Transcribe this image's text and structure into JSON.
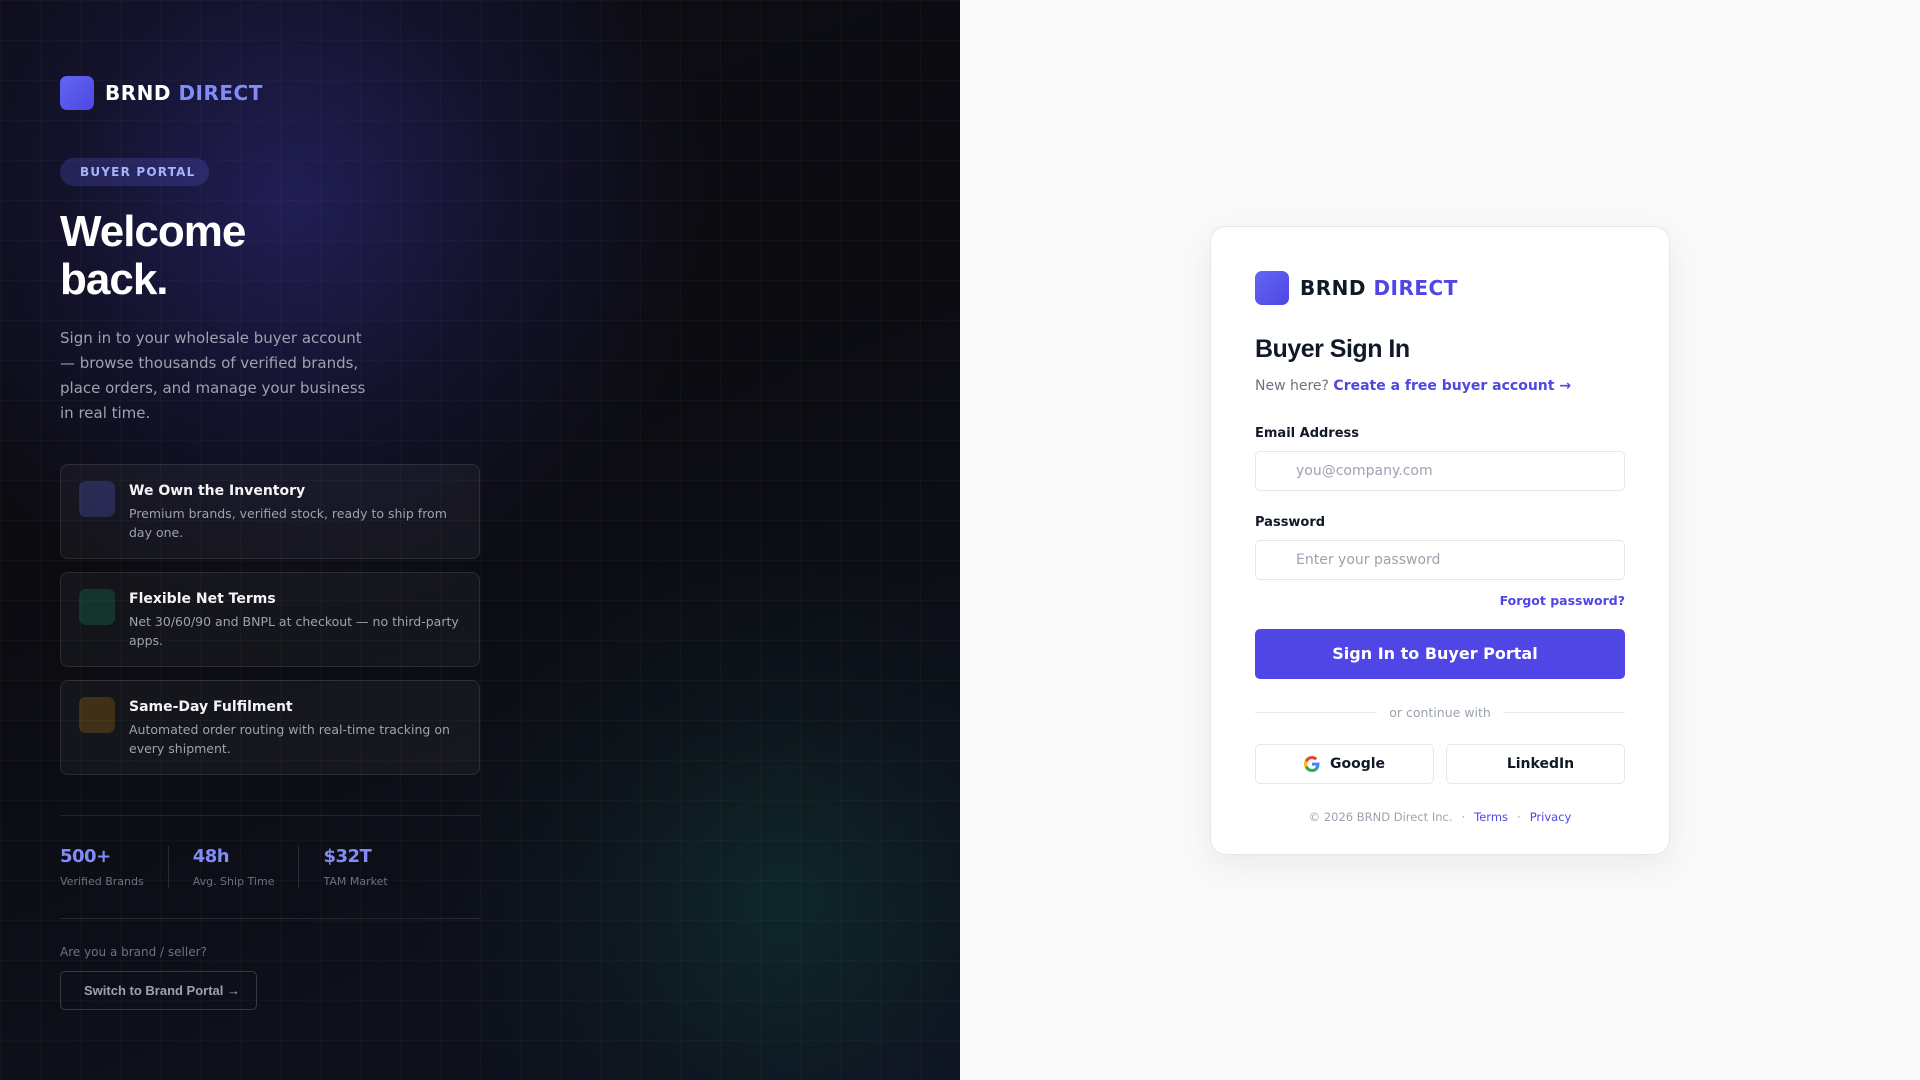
{
  "brand": {
    "name_primary": "BRND",
    "name_accent": "DIRECT",
    "logo_icon": "",
    "colors": {
      "accent": "#4f46e5",
      "accent_light": "#818cf8",
      "dark_bg": "#0b0b10"
    }
  },
  "left": {
    "badge_icon": "",
    "badge_label": "BUYER PORTAL",
    "headline_line1": "Welcome",
    "headline_line2": "back.",
    "intro": "Sign in to your wholesale buyer account — browse thousands of verified brands, place orders, and manage your business in real time.",
    "features": [
      {
        "icon": "",
        "icon_name": "warehouse-icon",
        "title": "We Own the Inventory",
        "description": "Premium brands, verified stock, ready to ship from day one."
      },
      {
        "icon": "",
        "icon_name": "credit-card-icon",
        "title": "Flexible Net Terms",
        "description": "Net 30/60/90 and BNPL at checkout — no third-party apps."
      },
      {
        "icon": "",
        "icon_name": "lightning-icon",
        "title": "Same-Day Fulfilment",
        "description": "Automated order routing with real-time tracking on every shipment."
      }
    ],
    "stats": [
      {
        "value": "500+",
        "label": "Verified Brands"
      },
      {
        "value": "48h",
        "label": "Avg. Ship Time"
      },
      {
        "value": "$32T",
        "label": "TAM Market"
      }
    ],
    "seller_question": "Are you a brand / seller?",
    "switch_icon": "",
    "switch_label": "Switch to Brand Portal →"
  },
  "card": {
    "title": "Buyer Sign In",
    "new_here": "New here?",
    "create_account": "Create a free buyer account →",
    "email_label": "Email Address",
    "email_icon": "",
    "email_placeholder": "you@company.com",
    "email_value": "",
    "password_label": "Password",
    "password_icon": "",
    "password_placeholder": "Enter your password",
    "password_value": "",
    "eye_icon": "",
    "forgot": "Forgot password?",
    "submit_label": "Sign In to Buyer Portal",
    "submit_icon": "",
    "divider_text": "or continue with",
    "google_label": "Google",
    "linkedin_icon": "",
    "linkedin_label": "LinkedIn",
    "copyright": "© 2026 BRND Direct Inc.",
    "separator": "·",
    "terms": "Terms",
    "privacy": "Privacy"
  }
}
